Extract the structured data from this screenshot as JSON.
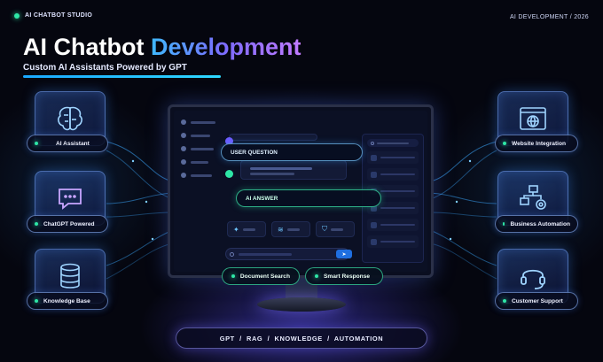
{
  "top": {
    "studio": "AI CHATBOT STUDIO",
    "edition": "AI DEVELOPMENT / 2026"
  },
  "title": {
    "main": "AI Chatbot ",
    "highlight": "Development",
    "subtitle": "Custom AI Assistants Powered by GPT"
  },
  "left_features": [
    {
      "label": "AI Assistant",
      "icon": "brain-icon"
    },
    {
      "label": "ChatGPT Powered",
      "icon": "chat-bubble-icon"
    },
    {
      "label": "Knowledge Base",
      "icon": "database-icon"
    }
  ],
  "right_features": [
    {
      "label": "Website Integration",
      "icon": "globe-window-icon"
    },
    {
      "label": "Business Automation",
      "icon": "workflow-gear-icon"
    },
    {
      "label": "Customer Support",
      "icon": "headset-icon"
    }
  ],
  "chat": {
    "user_question": "USER QUESTION",
    "ai_answer": "AI ANSWER"
  },
  "under_monitor": {
    "doc_search": "Document Search",
    "smart_response": "Smart Response"
  },
  "bottom_bar": "GPT  /  RAG  /  KNOWLEDGE  /  AUTOMATION",
  "colors": {
    "accent_green": "#2ee6a6",
    "accent_blue": "#1aa8ff",
    "accent_purple": "#7d6bff",
    "background": "#05060f"
  }
}
